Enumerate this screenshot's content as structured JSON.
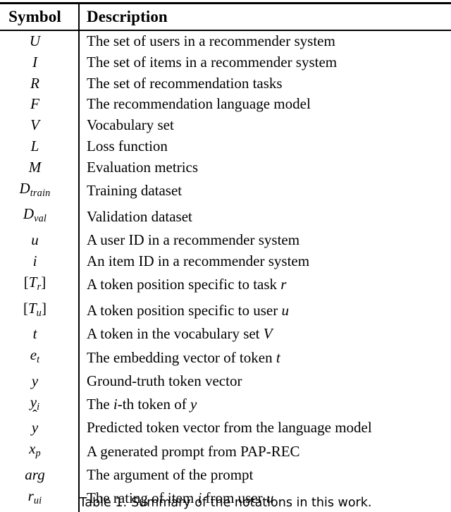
{
  "table": {
    "columns": {
      "symbol_header": "Symbol",
      "description_header": "Description"
    },
    "rows": [
      {
        "symbol": "U",
        "description": "The set of users in a recommender system"
      },
      {
        "symbol": "I",
        "description": "The set of items in a recommender system"
      },
      {
        "symbol": "R",
        "description": "The set of recommendation tasks"
      },
      {
        "symbol": "F",
        "description": "The recommendation language model"
      },
      {
        "symbol": "V",
        "description": "Vocabulary set"
      },
      {
        "symbol": "L",
        "description": "Loss function"
      },
      {
        "symbol": "M",
        "description": "Evaluation metrics"
      },
      {
        "symbol": "D_train",
        "description": "Training dataset"
      },
      {
        "symbol": "D_val",
        "description": "Validation dataset"
      },
      {
        "symbol": "u",
        "description": "A user ID in a recommender system"
      },
      {
        "symbol": "i",
        "description": "An item ID in a recommender system"
      },
      {
        "symbol": "[T_r]",
        "description": "A token position specific to task r"
      },
      {
        "symbol": "[T_u]",
        "description": "A token position specific to user u"
      },
      {
        "symbol": "t",
        "description": "A token in the vocabulary set V"
      },
      {
        "symbol": "e_t",
        "description": "The embedding vector of token t"
      },
      {
        "symbol": "y",
        "description": "Ground-truth token vector"
      },
      {
        "symbol": "y_i",
        "description": "The i-th token of y"
      },
      {
        "symbol": "y_hat",
        "description": "Predicted token vector from the language model"
      },
      {
        "symbol": "x_p",
        "description": "A generated prompt from PAP-REC"
      },
      {
        "symbol": "arg",
        "description": "The argument of the prompt"
      },
      {
        "symbol": "r_ui",
        "description": "The rating of item i from user u"
      }
    ]
  },
  "caption": {
    "label": "Table 1.",
    "text": "Summary of the notations in this work."
  },
  "colors": {
    "text": "#000000",
    "rule": "#000000",
    "background": "#ffffff"
  }
}
